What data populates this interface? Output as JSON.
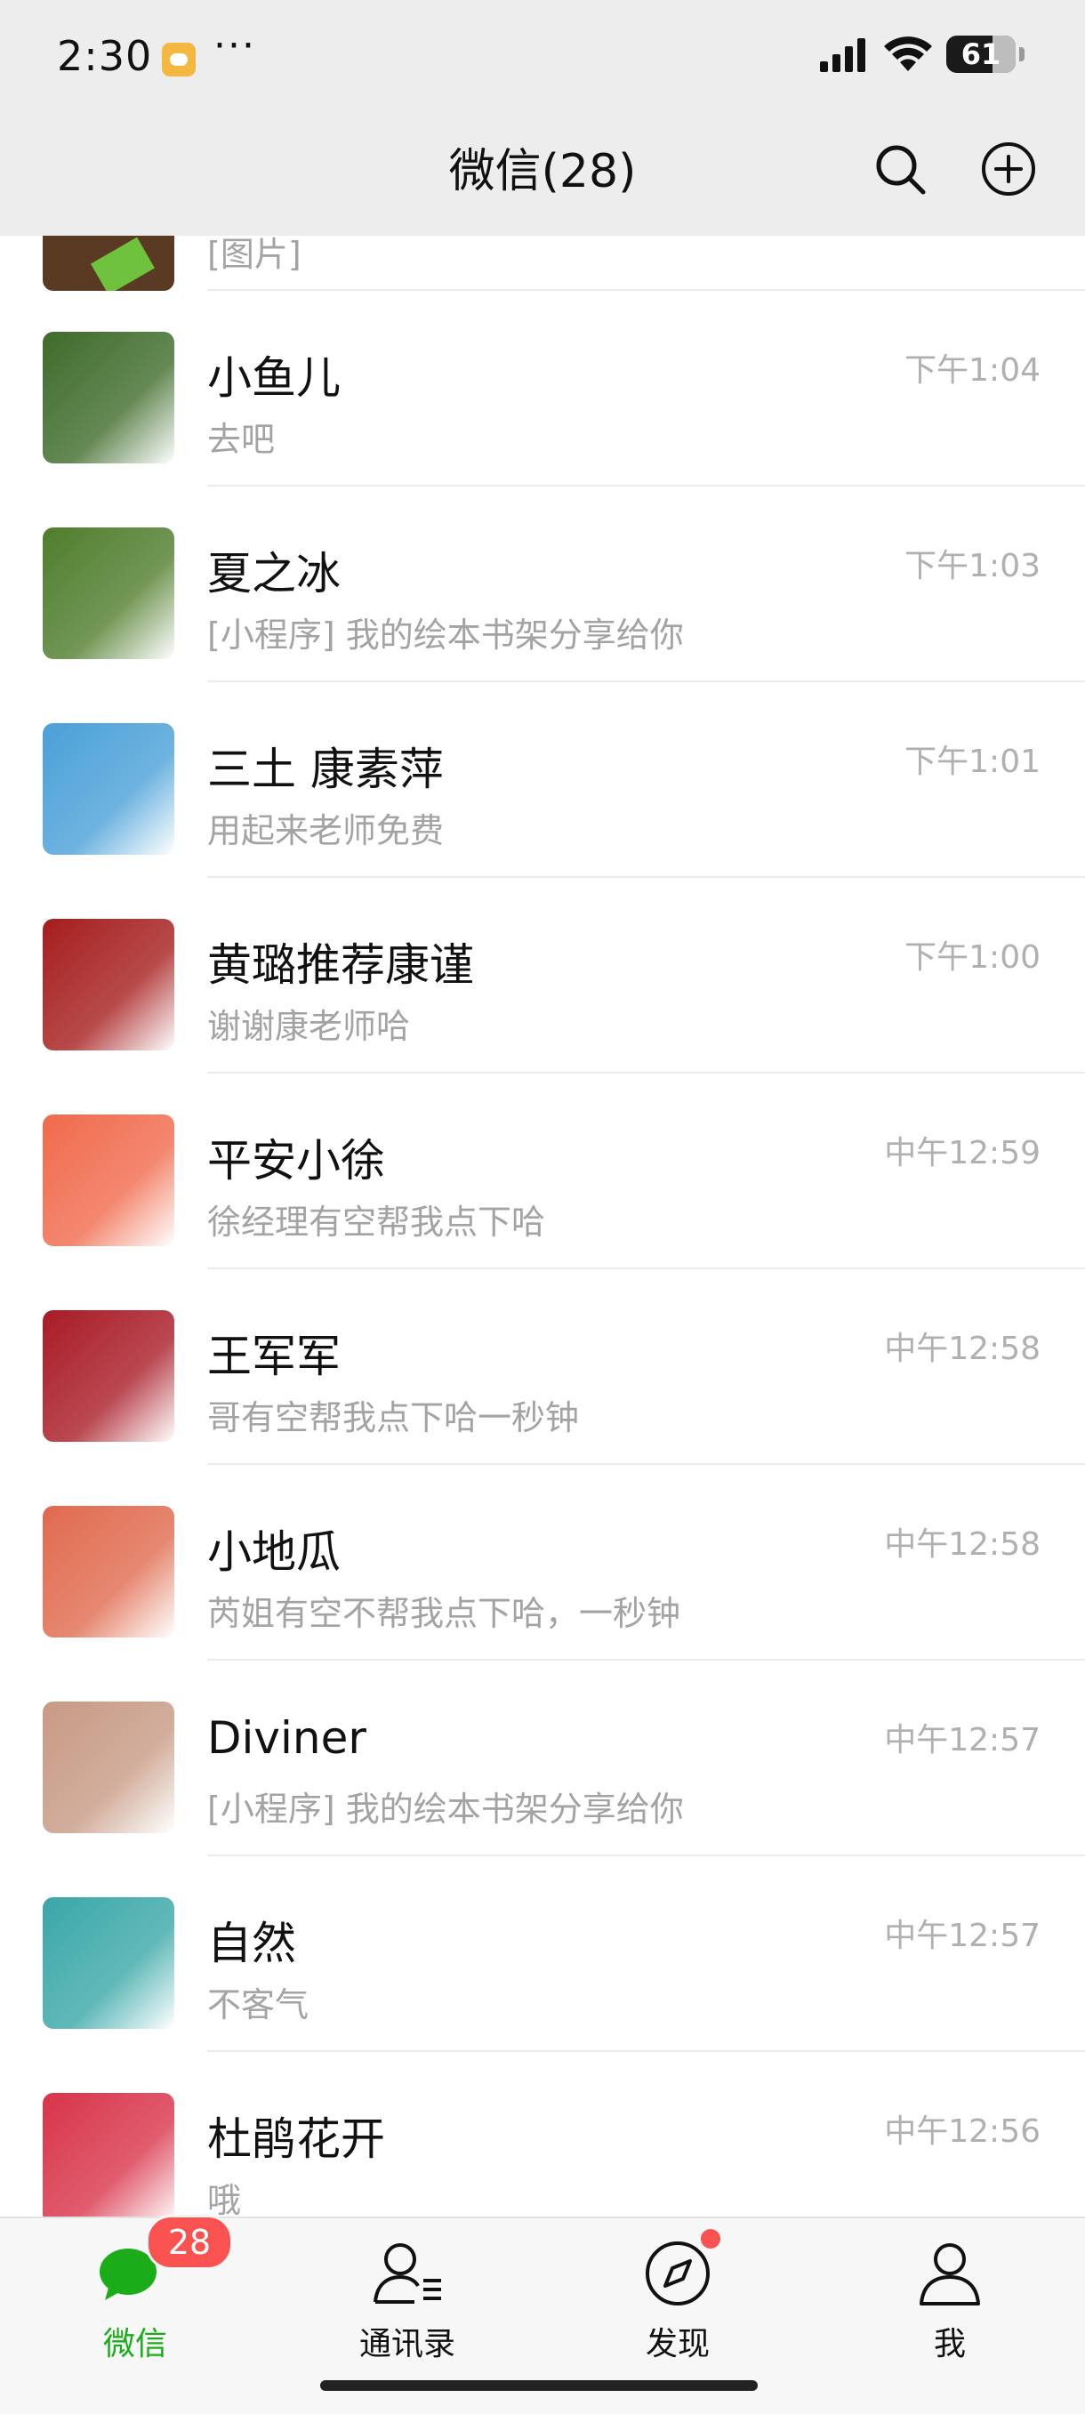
{
  "status_bar": {
    "time": "2:30",
    "dots": "···",
    "battery": "61"
  },
  "header": {
    "title": "微信(28)"
  },
  "partial_row": {
    "message": "[图片]"
  },
  "chats": [
    {
      "name": "小鱼儿",
      "message": "去吧",
      "time": "下午1:04"
    },
    {
      "name": "夏之冰",
      "message": "[小程序] 我的绘本书架分享给你",
      "time": "下午1:03"
    },
    {
      "name": "三土 康素萍",
      "message": "用起来老师免费",
      "time": "下午1:01"
    },
    {
      "name": "黄璐推荐康谨",
      "message": "谢谢康老师哈",
      "time": "下午1:00"
    },
    {
      "name": "平安小徐",
      "message": "徐经理有空帮我点下哈",
      "time": "中午12:59"
    },
    {
      "name": "王军军",
      "message": "哥有空帮我点下哈一秒钟",
      "time": "中午12:58"
    },
    {
      "name": "小地瓜",
      "message": "芮姐有空不帮我点下哈，一秒钟",
      "time": "中午12:58"
    },
    {
      "name": "Diviner",
      "message": "[小程序] 我的绘本书架分享给你",
      "time": "中午12:57"
    },
    {
      "name": "自然",
      "message": "不客气",
      "time": "中午12:57"
    },
    {
      "name": "杜鹃花开",
      "message": "哦",
      "time": "中午12:56"
    }
  ],
  "avatar_colors": [
    "#3e6b2a",
    "#4f7d2c",
    "#4aa0d8",
    "#a61d1d",
    "#f06a4c",
    "#a81b26",
    "#e06a4e",
    "#c79a84",
    "#3aa7a8",
    "#d8344a"
  ],
  "tabbar": {
    "tabs": [
      {
        "label": "微信",
        "icon": "chat-bubbles-icon",
        "badge": "28",
        "active": true
      },
      {
        "label": "通讯录",
        "icon": "contacts-icon"
      },
      {
        "label": "发现",
        "icon": "compass-icon",
        "dot": true
      },
      {
        "label": "我",
        "icon": "person-icon"
      }
    ]
  },
  "colors": {
    "accent": "#1aad19",
    "badge": "#fa5151",
    "header_bg": "#ededed"
  }
}
